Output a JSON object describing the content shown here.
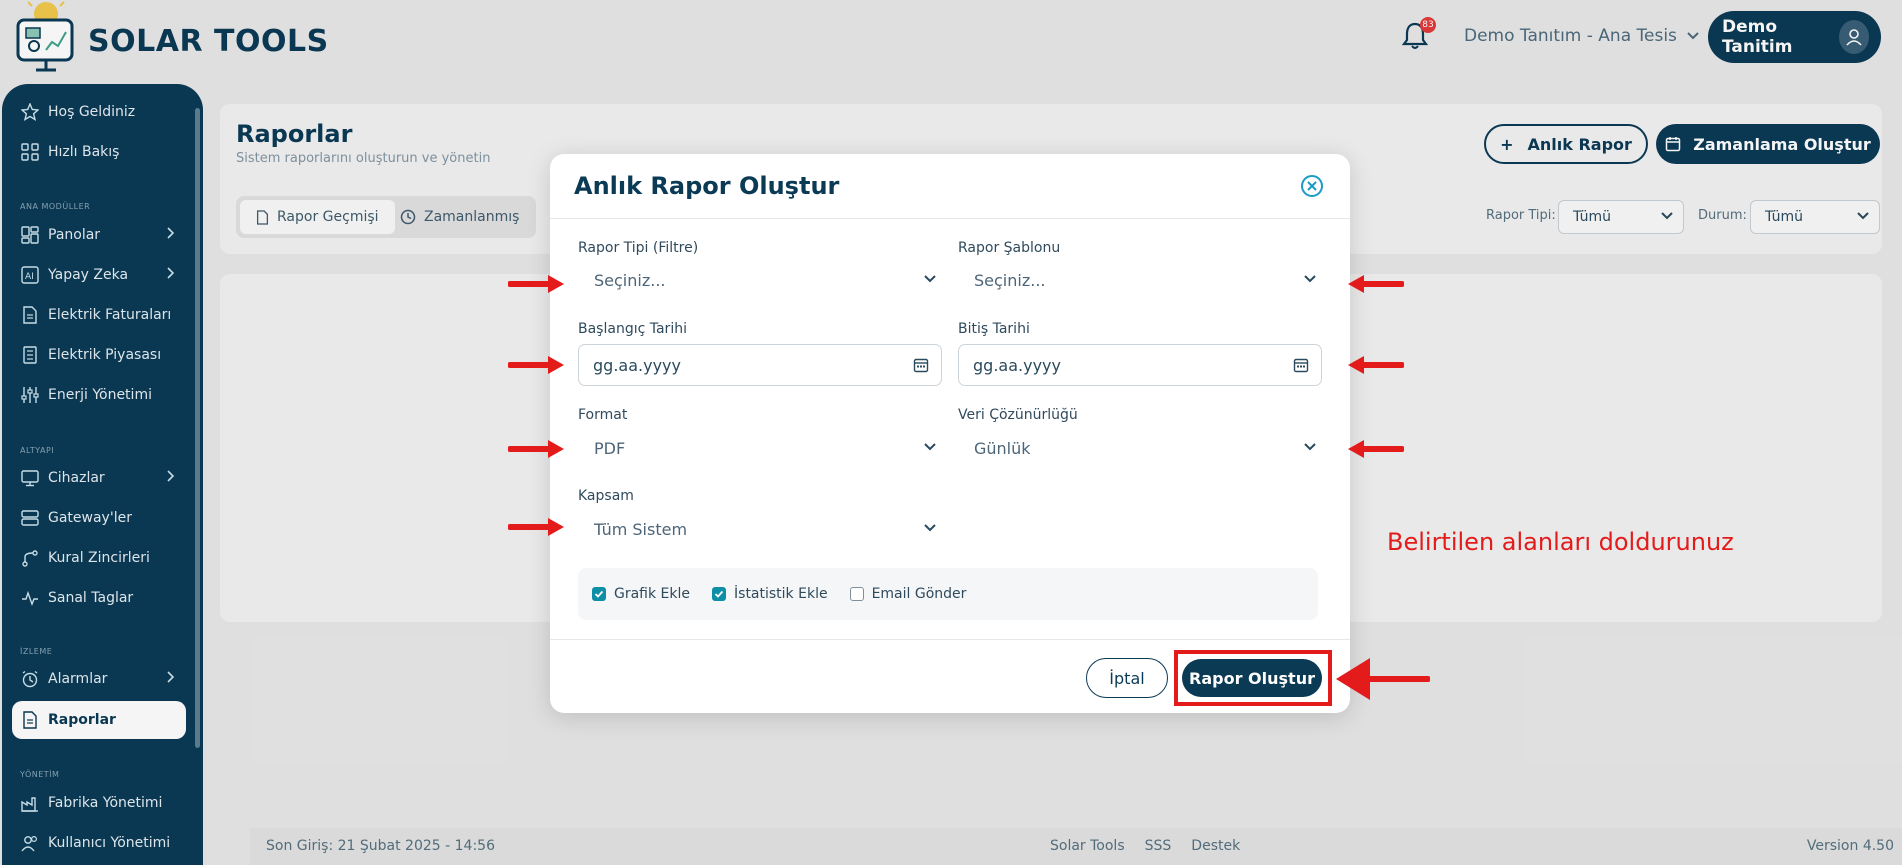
{
  "header": {
    "brand": "SOLAR TOOLS",
    "notification_count": "83",
    "facility": "Demo Tanıtım - Ana Tesis",
    "user": "Demo Tanitim"
  },
  "sidebar": {
    "sections": {
      "main": "ANA MODÜLLER",
      "infra": "ALTYAPI",
      "monitor": "İZLEME",
      "admin": "YÖNETİM"
    },
    "items": [
      {
        "label": "Hoş Geldiniz"
      },
      {
        "label": "Hızlı Bakış"
      },
      {
        "label": "Panolar"
      },
      {
        "label": "Yapay Zeka"
      },
      {
        "label": "Elektrik Faturaları"
      },
      {
        "label": "Elektrik Piyasası"
      },
      {
        "label": "Enerji Yönetimi"
      },
      {
        "label": "Cihazlar"
      },
      {
        "label": "Gateway'ler"
      },
      {
        "label": "Kural Zincirleri"
      },
      {
        "label": "Sanal Taglar"
      },
      {
        "label": "Alarmlar"
      },
      {
        "label": "Raporlar"
      },
      {
        "label": "Fabrika Yönetimi"
      },
      {
        "label": "Kullanıcı Yönetimi"
      }
    ]
  },
  "page": {
    "title": "Raporlar",
    "subtitle": "Sistem raporlarını oluşturun ve yönetin",
    "tabs": [
      "Rapor Geçmişi",
      "Zamanlanmış"
    ],
    "btn_instant": "Anlık Rapor",
    "btn_schedule": "Zamanlama Oluştur",
    "filter_type_label": "Rapor Tipi:",
    "filter_type_value": "Tümü",
    "filter_status_label": "Durum:",
    "filter_status_value": "Tümü"
  },
  "footer": {
    "last_login": "Son Giriş: 21 Şubat 2025 - 14:56",
    "links": [
      "Solar Tools",
      "SSS",
      "Destek"
    ],
    "version": "Version 4.50"
  },
  "modal": {
    "title": "Anlık Rapor Oluştur",
    "report_type_label": "Rapor Tipi (Filtre)",
    "report_type_value": "Seçiniz...",
    "template_label": "Rapor Şablonu",
    "template_value": "Seçiniz...",
    "start_label": "Başlangıç Tarihi",
    "start_placeholder": "gg.aa.yyyy",
    "end_label": "Bitiş Tarihi",
    "end_placeholder": "gg.aa.yyyy",
    "format_label": "Format",
    "format_value": "PDF",
    "resolution_label": "Veri Çözünürlüğü",
    "resolution_value": "Günlük",
    "scope_label": "Kapsam",
    "scope_value": "Tüm Sistem",
    "options": [
      {
        "label": "Grafik Ekle",
        "checked": true
      },
      {
        "label": "İstatistik Ekle",
        "checked": true
      },
      {
        "label": "Email Gönder",
        "checked": false
      }
    ],
    "cancel": "İptal",
    "submit": "Rapor Oluştur"
  },
  "annotation": {
    "note": "Belirtilen alanları doldurunuz",
    "color": "#e31b1b"
  }
}
